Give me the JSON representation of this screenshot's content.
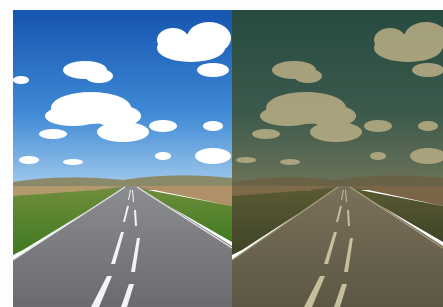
{
  "image": {
    "description_panels": [
      "original",
      "filtered"
    ],
    "colors": {
      "sky_top": "#1a5fb8",
      "sky_bottom": "#7fb3e6",
      "cloud": "#ffffff",
      "grass": "#4f8a2c",
      "field": "#b9a070",
      "road": "#7a7a7c",
      "road_marking": "#f2f2f2",
      "filter_overlay": "#3f3a1c",
      "filtered_sky_top": "#2f4a3d",
      "filtered_sky_bottom": "#5f6d55",
      "filtered_cloud": "#b8b08a",
      "filtered_ground": "#5e5a3e",
      "filtered_road": "#6d6650"
    }
  }
}
